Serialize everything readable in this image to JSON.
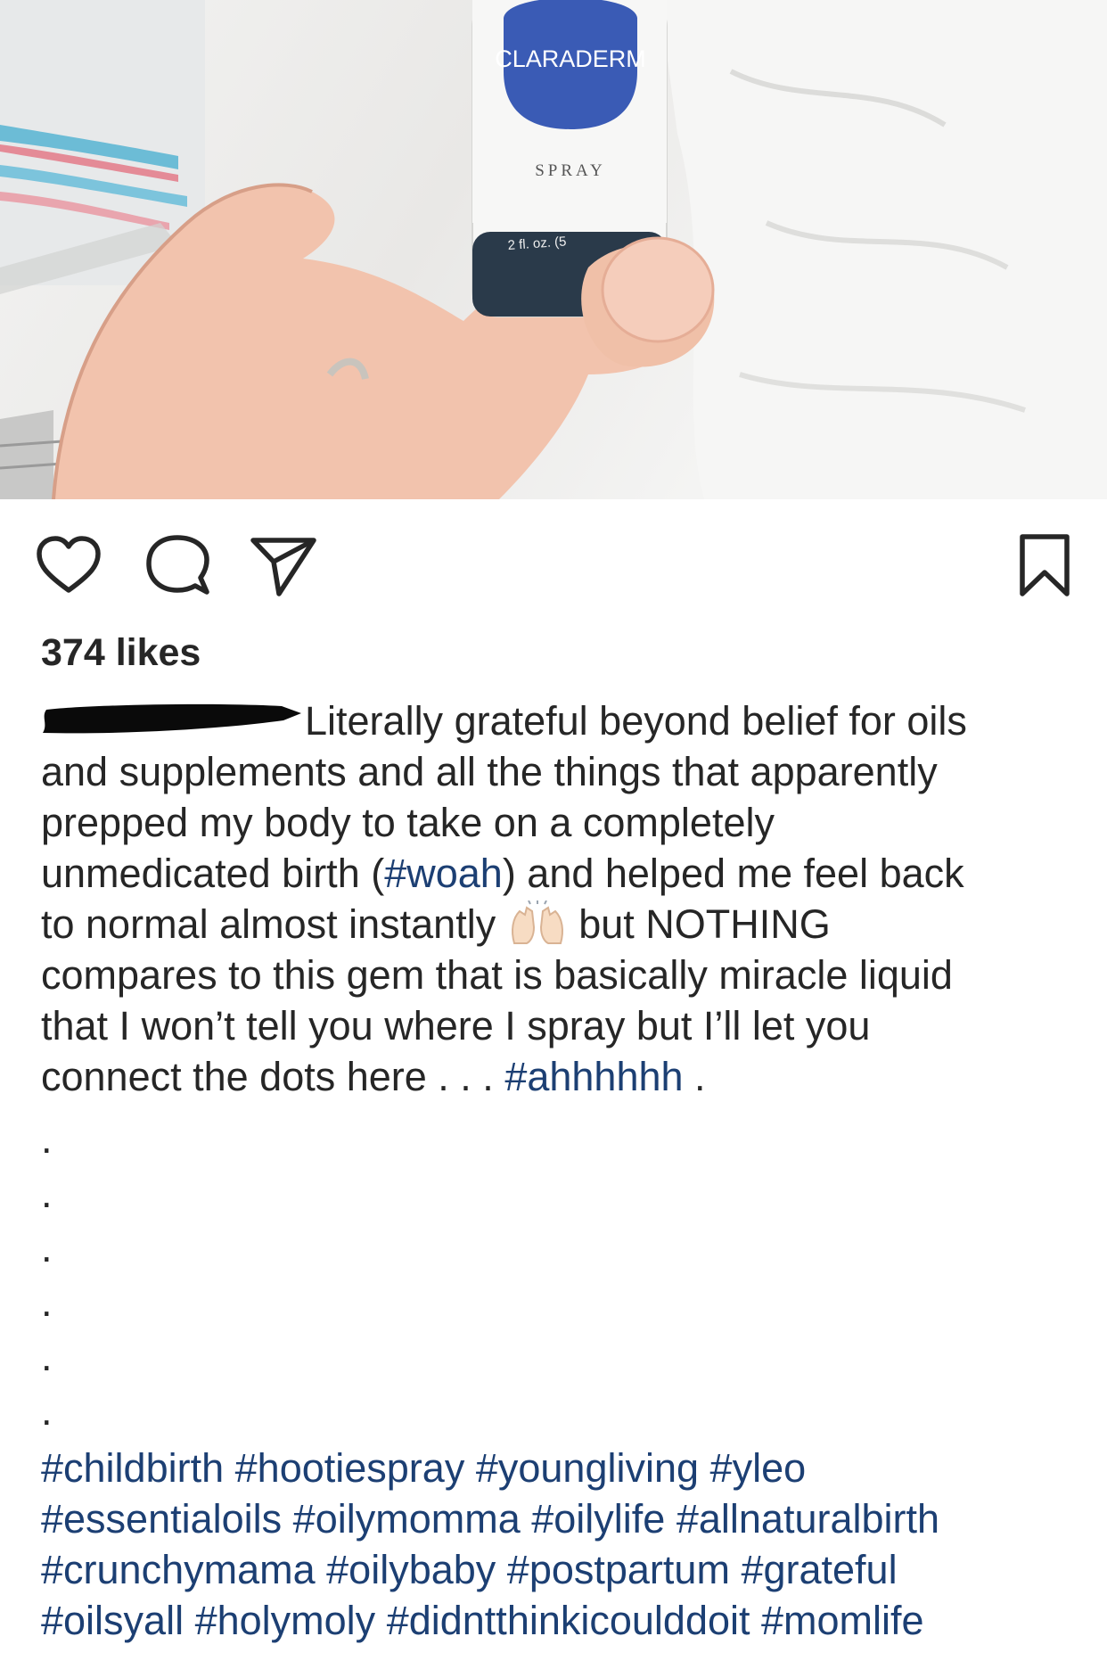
{
  "post": {
    "image": {
      "product_brand": "CLARADERM",
      "product_type": "SPRAY",
      "product_size": "2 fl. oz. (5"
    },
    "likes": "374 likes",
    "caption": {
      "line1": "Literally grateful beyond belief for oils",
      "line2": "and supplements and all the things that apparently",
      "line3": "prepped my body to take on a completely",
      "line4_pre": "unmedicated birth (",
      "line4_tag": "#woah",
      "line4_post": ") and helped me feel back",
      "line5_pre": "to normal almost instantly ",
      "line5_post": " but NOTHING",
      "line6": "compares to this gem that is basically miracle liquid",
      "line7": "that I won’t tell you where I spray but I’ll let you",
      "line8_pre": "connect the dots here . . . ",
      "line8_tag": "#ahhhhhh",
      "line8_post": " ."
    },
    "spacer_dots": [
      ".",
      ".",
      ".",
      ".",
      ".",
      "."
    ],
    "hashtag_lines": [
      [
        "#childbirth",
        "#hootiespray",
        "#youngliving",
        "#yleo"
      ],
      [
        "#essentialoils",
        "#oilymomma",
        "#oilylife",
        "#allnaturalbirth"
      ],
      [
        "#crunchymama",
        "#oilybaby",
        "#postpartum",
        "#grateful"
      ],
      [
        "#oilsyall",
        "#holymoly",
        "#didntthinkicoulddoit",
        "#momlife"
      ]
    ]
  },
  "icons": {
    "like": "heart-icon",
    "comment": "comment-bubble-icon",
    "share": "paper-plane-icon",
    "save": "bookmark-icon",
    "emoji": "raising-hands-emoji"
  },
  "colors": {
    "text": "#262626",
    "hashtag": "#1c3f73",
    "bottle_label": "#3a5bb5"
  }
}
